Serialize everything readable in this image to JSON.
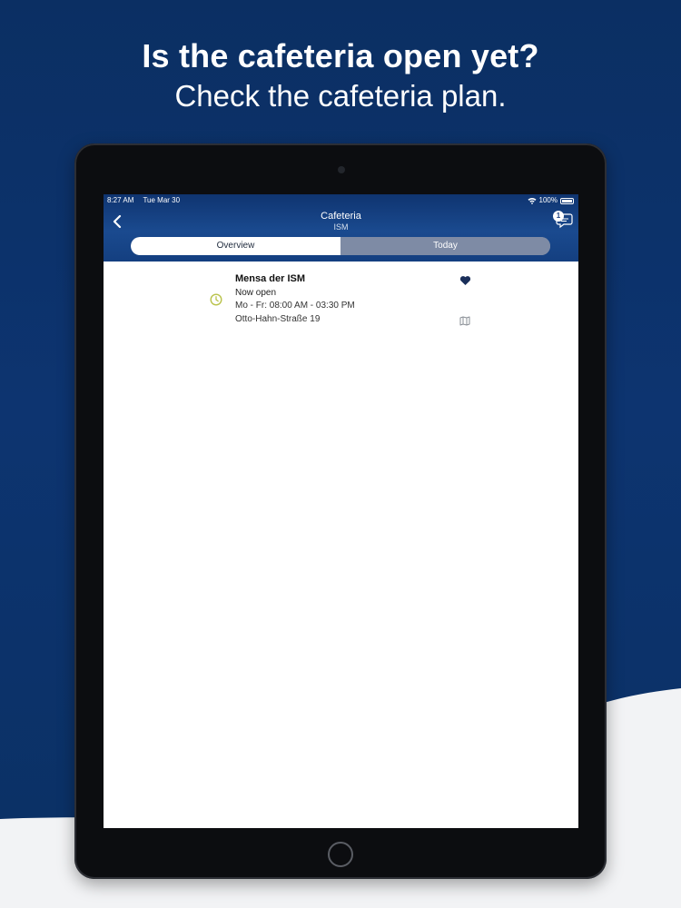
{
  "headline": {
    "title": "Is the cafeteria open yet?",
    "subtitle": "Check the cafeteria plan."
  },
  "status_bar": {
    "time": "8:27 AM",
    "date": "Tue Mar 30",
    "battery": "100%"
  },
  "nav": {
    "title": "Cafeteria",
    "subtitle": "ISM",
    "message_badge": "1"
  },
  "tabs": [
    {
      "label": "Overview",
      "active": true
    },
    {
      "label": "Today",
      "active": false
    }
  ],
  "cafeterias": [
    {
      "name": "Mensa der ISM",
      "status": "Now open",
      "hours": "Mo - Fr: 08:00 AM - 03:30 PM",
      "address": "Otto-Hahn-Straße 19",
      "favorite": true,
      "icons": [
        "clock-icon",
        "heart-icon",
        "map-icon"
      ]
    }
  ],
  "colors": {
    "brand_blue": "#0b3166",
    "appbar_blue": "#1a4a8f",
    "clock_green": "#b9c24a",
    "heart_navy": "#1a2f5a"
  }
}
